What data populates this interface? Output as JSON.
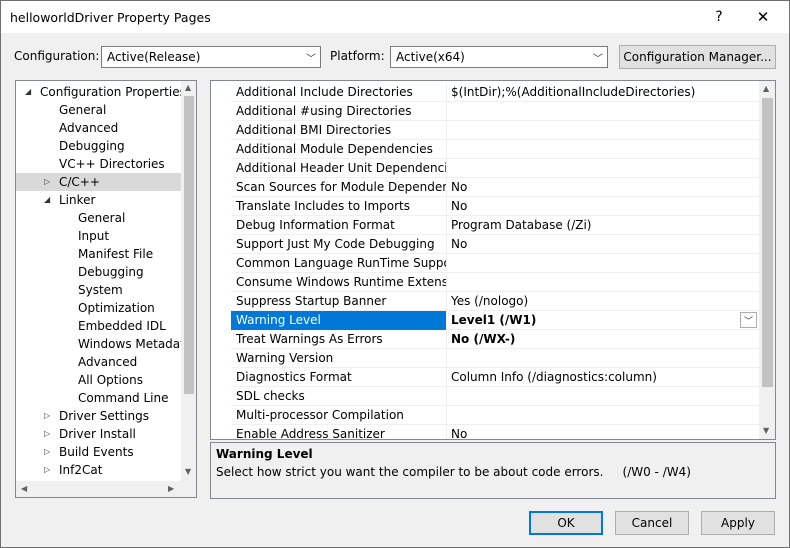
{
  "window": {
    "title": "helloworldDriver Property Pages",
    "help_label": "?",
    "close_label": "✕"
  },
  "toolbar": {
    "configuration_label": "Configuration:",
    "configuration_value": "Active(Release)",
    "platform_label": "Platform:",
    "platform_value": "Active(x64)",
    "config_manager_label": "Configuration Manager..."
  },
  "tree": {
    "items": [
      {
        "label": "Configuration Properties",
        "twisty": "◢"
      },
      {
        "label": "General"
      },
      {
        "label": "Advanced"
      },
      {
        "label": "Debugging"
      },
      {
        "label": "VC++ Directories"
      },
      {
        "label": "C/C++",
        "twisty": "▷",
        "selected": true
      },
      {
        "label": "Linker",
        "twisty": "◢"
      },
      {
        "label": "General"
      },
      {
        "label": "Input"
      },
      {
        "label": "Manifest File"
      },
      {
        "label": "Debugging"
      },
      {
        "label": "System"
      },
      {
        "label": "Optimization"
      },
      {
        "label": "Embedded IDL"
      },
      {
        "label": "Windows Metadata"
      },
      {
        "label": "Advanced"
      },
      {
        "label": "All Options"
      },
      {
        "label": "Command Line"
      },
      {
        "label": "Driver Settings",
        "twisty": "▷"
      },
      {
        "label": "Driver Install",
        "twisty": "▷"
      },
      {
        "label": "Build Events",
        "twisty": "▷"
      },
      {
        "label": "Inf2Cat",
        "twisty": "▷"
      }
    ]
  },
  "properties": {
    "rows": [
      {
        "name": "Additional Include Directories",
        "value": "$(IntDir);%(AdditionalIncludeDirectories)"
      },
      {
        "name": "Additional #using Directories",
        "value": ""
      },
      {
        "name": "Additional BMI Directories",
        "value": ""
      },
      {
        "name": "Additional Module Dependencies",
        "value": ""
      },
      {
        "name": "Additional Header Unit Dependencies",
        "value": ""
      },
      {
        "name": "Scan Sources for Module Dependencies",
        "value": "No"
      },
      {
        "name": "Translate Includes to Imports",
        "value": "No"
      },
      {
        "name": "Debug Information Format",
        "value": "Program Database (/Zi)"
      },
      {
        "name": "Support Just My Code Debugging",
        "value": "No"
      },
      {
        "name": "Common Language RunTime Support",
        "value": ""
      },
      {
        "name": "Consume Windows Runtime Extension",
        "value": ""
      },
      {
        "name": "Suppress Startup Banner",
        "value": "Yes (/nologo)"
      },
      {
        "name": "Warning Level",
        "value": "Level1 (/W1)",
        "selected": true,
        "bold": true
      },
      {
        "name": "Treat Warnings As Errors",
        "value": "No (/WX-)",
        "bold": true
      },
      {
        "name": "Warning Version",
        "value": ""
      },
      {
        "name": "Diagnostics Format",
        "value": "Column Info (/diagnostics:column)"
      },
      {
        "name": "SDL checks",
        "value": ""
      },
      {
        "name": "Multi-processor Compilation",
        "value": ""
      },
      {
        "name": "Enable Address Sanitizer",
        "value": "No"
      }
    ]
  },
  "description": {
    "title": "Warning Level",
    "text": "Select how strict you want the compiler to be about code errors.     (/W0 - /W4)"
  },
  "buttons": {
    "ok": "OK",
    "cancel": "Cancel",
    "apply": "Apply"
  },
  "icons": {
    "dropdown": "chevron-down-icon",
    "expand": "expand-triangle-icon",
    "collapse": "collapse-triangle-icon"
  }
}
